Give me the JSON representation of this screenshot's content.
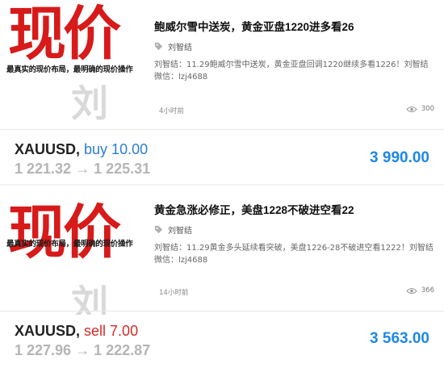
{
  "posts": [
    {
      "thumb": {
        "big_text": "现价",
        "tagline": "最真实的现价布局，最明确的现价操作",
        "watermark": "刘智"
      },
      "title": "鲍威尔雪中送炭，黄金亚盘1220进多看26",
      "author": "刘智结",
      "description": "刘智结：11.29鲍威尔雪中送炭，黄金亚盘回调1220继续多看1226！刘智结微信：lzj4688",
      "time": "4小时前",
      "views": "300",
      "trade": {
        "symbol": "XAUUSD,",
        "action": "buy 10.00",
        "open": "1 221.32",
        "arrow": "→",
        "close": "1 225.31",
        "amount": "3 990.00"
      }
    },
    {
      "thumb": {
        "big_text": "现价",
        "tagline": "最真实的现价布局，最明确的现价操作",
        "watermark": "刘智"
      },
      "title": "黄金急涨必修正，美盘1228不破进空看22",
      "author": "刘智结",
      "description": "刘智结：11.29黄金多头延续看突破，美盘1226-28不破进空看1222！刘智结微信：lzj4688",
      "time": "14小时前",
      "views": "366",
      "trade": {
        "symbol": "XAUUSD,",
        "action": "sell 7.00",
        "open": "1 227.96",
        "arrow": "→",
        "close": "1 222.87",
        "amount": "3 563.00"
      }
    }
  ],
  "colors": {
    "buy": "#2a7fd4",
    "sell": "#d52a2a",
    "amount": "#1e88e5",
    "thumb_red": "#d71a1a"
  },
  "icons": {
    "author": "tag-icon",
    "views": "eye-icon"
  }
}
